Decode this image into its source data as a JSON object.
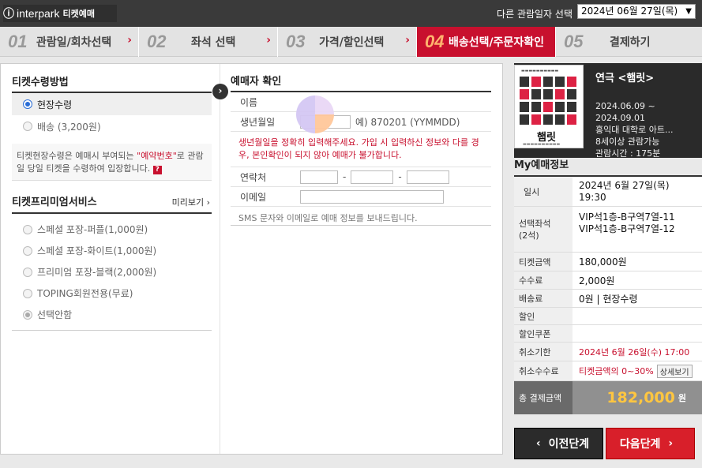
{
  "header": {
    "logo_mark": "ⓘ",
    "brand": "interpark",
    "sub": "티켓예매",
    "date_label": "다른 관람일자 선택",
    "date_value": "2024년 06월 27일(목)"
  },
  "steps": [
    {
      "num": "01",
      "label": "관람일/회차선택"
    },
    {
      "num": "02",
      "label": "좌석 선택"
    },
    {
      "num": "03",
      "label": "가격/할인선택"
    },
    {
      "num": "04",
      "label": "배송선택/주문자확인"
    },
    {
      "num": "05",
      "label": "결제하기"
    }
  ],
  "receive": {
    "title": "티켓수령방법",
    "options": [
      "현장수령",
      "배송 (3,200원)"
    ],
    "notice_1": "티켓현장수령은 예매시 부여되는 ",
    "notice_red": "\"예약번호\"",
    "notice_2": "로 관람일 당일 티켓을 수령하여 입장합니다.",
    "help": "?"
  },
  "premium": {
    "title": "티켓프리미엄서비스",
    "more": "미리보기 ›",
    "options": [
      "스페셜 포장-퍼플(1,000원)",
      "스페셜 포장-화이트(1,000원)",
      "프리미엄 포장-블랙(2,000원)",
      "TOPING회원전용(무료)",
      "선택안함"
    ]
  },
  "booker": {
    "title": "예매자 확인",
    "name_label": "이름",
    "birth_label": "생년월일",
    "birth_hint": "예) 870201 (YYMMDD)",
    "warning": "생년월일을 정확히 입력해주세요. 가입 시 입력하신 정보와 다를 경우, 본인확인이 되지 않아 예매가 불가합니다.",
    "phone_label": "연락처",
    "email_label": "이메일",
    "sms_note": "SMS 문자와 이메일로 예매 정보를 보내드립니다.",
    "dash": "-"
  },
  "show": {
    "poster_title": "햄릿",
    "title": "연극 <햄릿>",
    "info": [
      "2024.06.09 ~",
      "2024.09.01",
      "홍익대 대학로 아트...",
      "8세이상 관람가능",
      "관람시간 : 175분"
    ]
  },
  "my": {
    "title": "My예매정보",
    "rows": {
      "date_k": "일시",
      "date_v1": "2024년 6월 27일(목)",
      "date_v2": "19:30",
      "seat_k1": "선택좌석",
      "seat_k2": "(2석)",
      "seat_v1": "VIP석1층-B구역7열-11",
      "seat_v2": "VIP석1층-B구역7열-12",
      "price_k": "티켓금액",
      "price_v": "180,000원",
      "fee_k": "수수료",
      "fee_v": "2,000원",
      "ship_k": "배송료",
      "ship_v": "0원 | 현장수령",
      "disc_k": "할인",
      "disc_v": "",
      "coupon_k": "할인쿠폰",
      "coupon_v": "",
      "cancel_k": "취소기한",
      "cancel_v": "2024년 6월 26일(수) 17:00",
      "cfee_k": "취소수수료",
      "cfee_v": "티켓금액의 0~30%",
      "detail": "상세보기"
    },
    "total_k": "총 결제금액",
    "total_v": "182,000",
    "total_unit": "원"
  },
  "buttons": {
    "prev": "이전단계",
    "next": "다음단계"
  }
}
